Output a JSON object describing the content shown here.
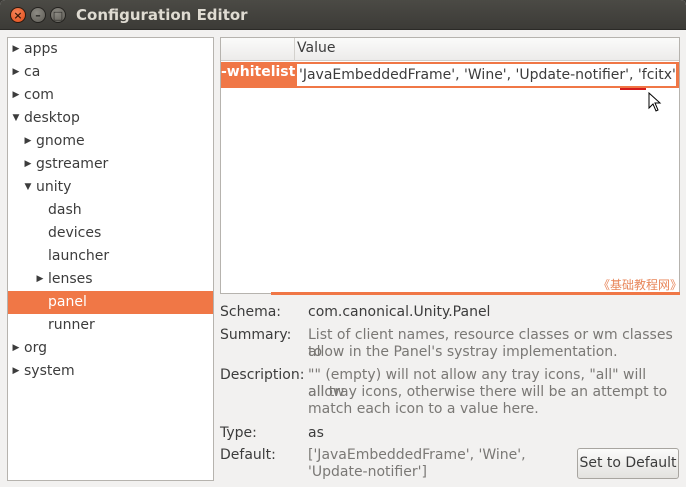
{
  "window": {
    "title": "Configuration Editor"
  },
  "tree": [
    {
      "label": "apps",
      "level": 0,
      "expanded": false,
      "selected": false
    },
    {
      "label": "ca",
      "level": 0,
      "expanded": false,
      "selected": false
    },
    {
      "label": "com",
      "level": 0,
      "expanded": false,
      "selected": false
    },
    {
      "label": "desktop",
      "level": 0,
      "expanded": true,
      "selected": false
    },
    {
      "label": "gnome",
      "level": 1,
      "expanded": false,
      "selected": false
    },
    {
      "label": "gstreamer",
      "level": 1,
      "expanded": false,
      "selected": false
    },
    {
      "label": "unity",
      "level": 1,
      "expanded": true,
      "selected": false
    },
    {
      "label": "dash",
      "level": 2,
      "leaf": true,
      "selected": false
    },
    {
      "label": "devices",
      "level": 2,
      "leaf": true,
      "selected": false
    },
    {
      "label": "launcher",
      "level": 2,
      "leaf": true,
      "selected": false
    },
    {
      "label": "lenses",
      "level": 2,
      "expanded": false,
      "selected": false
    },
    {
      "label": "panel",
      "level": 2,
      "leaf": true,
      "selected": true
    },
    {
      "label": "runner",
      "level": 2,
      "leaf": true,
      "selected": false
    },
    {
      "label": "org",
      "level": 0,
      "expanded": false,
      "selected": false
    },
    {
      "label": "system",
      "level": 0,
      "expanded": false,
      "selected": false
    }
  ],
  "keylist": {
    "header_value": "Value",
    "key_name": "-whitelist",
    "value": "'JavaEmbeddedFrame', 'Wine', 'Update-notifier', 'fcitx']"
  },
  "watermark": "《基础教程网》",
  "details": {
    "schema_label": "Schema:",
    "schema": "com.canonical.Unity.Panel",
    "summary_label": "Summary:",
    "summary_1": "List of client names, resource classes or wm classes to",
    "summary_2": "allow in the Panel's systray implementation.",
    "description_label": "Description:",
    "description_1": "\"\" (empty) will not allow any tray icons, \"all\" will allow",
    "description_2": "all tray icons, otherwise there will be an attempt to",
    "description_3": "match each icon to a value here.",
    "type_label": "Type:",
    "type": "as",
    "default_label": "Default:",
    "default_1": "['JavaEmbeddedFrame', 'Wine',",
    "default_2": "'Update-notifier']",
    "set_default_button": "Set to Default"
  },
  "colors": {
    "accent": "#f07746",
    "titlebar": "#3c3b37",
    "window_bg": "#f2f1f0"
  }
}
